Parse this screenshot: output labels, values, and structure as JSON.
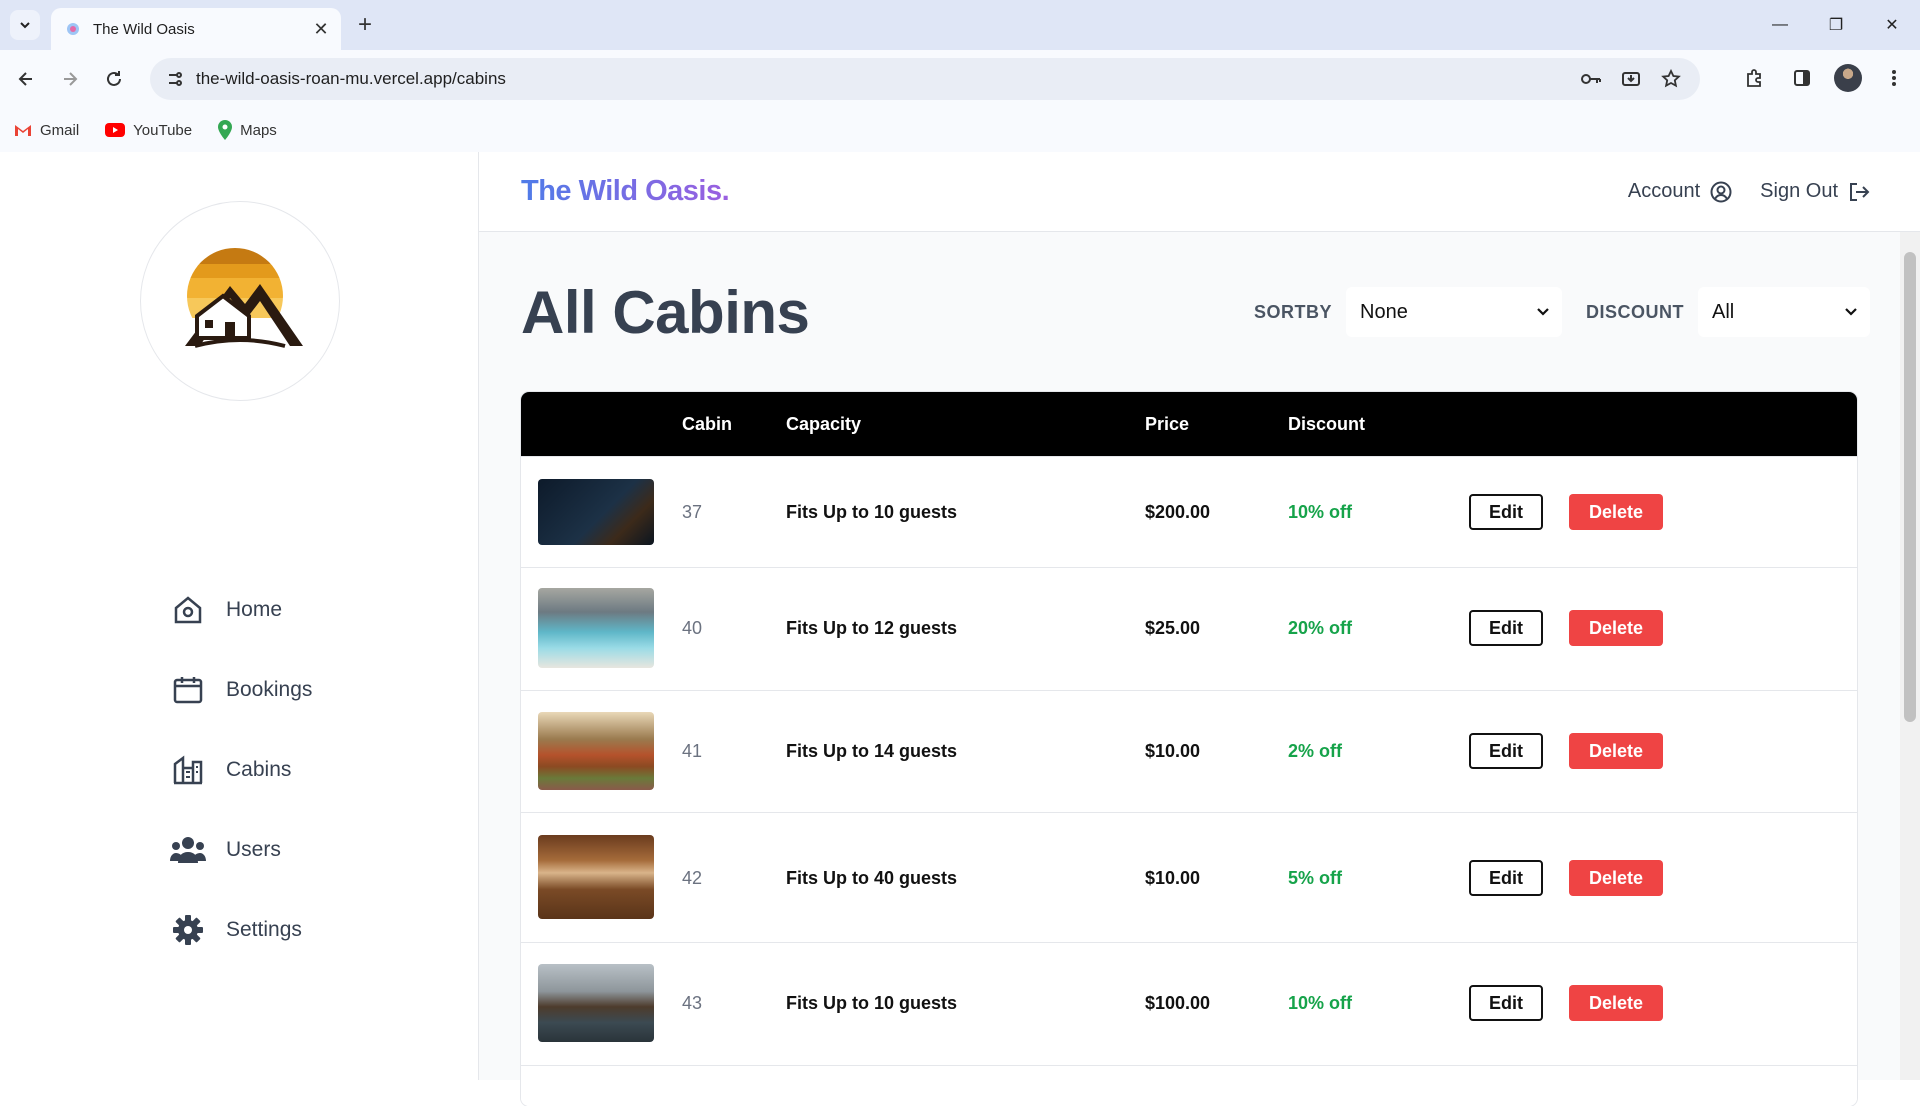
{
  "browser": {
    "tab_title": "The Wild Oasis",
    "url": "the-wild-oasis-roan-mu.vercel.app/cabins",
    "bookmarks": [
      {
        "label": "Gmail",
        "icon": "gmail-icon"
      },
      {
        "label": "YouTube",
        "icon": "youtube-icon"
      },
      {
        "label": "Maps",
        "icon": "maps-icon"
      }
    ]
  },
  "sidebar": {
    "items": [
      {
        "label": "Home",
        "icon": "home-icon"
      },
      {
        "label": "Bookings",
        "icon": "calendar-icon"
      },
      {
        "label": "Cabins",
        "icon": "building-icon"
      },
      {
        "label": "Users",
        "icon": "users-icon"
      },
      {
        "label": "Settings",
        "icon": "gear-icon"
      }
    ]
  },
  "header": {
    "brand": "The Wild Oasis.",
    "account_label": "Account",
    "signout_label": "Sign Out"
  },
  "page": {
    "title": "All Cabins",
    "sortby_label": "SORTBY",
    "sortby_value": "None",
    "discount_label": "DISCOUNT",
    "discount_value": "All"
  },
  "table": {
    "headers": {
      "cabin": "Cabin",
      "capacity": "Capacity",
      "price": "Price",
      "discount": "Discount"
    },
    "edit_label": "Edit",
    "delete_label": "Delete",
    "rows": [
      {
        "cabin": "37",
        "capacity": "Fits Up to 10 guests",
        "price": "$200.00",
        "discount": "10% off"
      },
      {
        "cabin": "40",
        "capacity": "Fits Up to 12 guests",
        "price": "$25.00",
        "discount": "20% off"
      },
      {
        "cabin": "41",
        "capacity": "Fits Up to 14 guests",
        "price": "$10.00",
        "discount": "2% off"
      },
      {
        "cabin": "42",
        "capacity": "Fits Up to 40 guests",
        "price": "$10.00",
        "discount": "5% off"
      },
      {
        "cabin": "43",
        "capacity": "Fits Up to 10 guests",
        "price": "$100.00",
        "discount": "10% off"
      }
    ]
  },
  "colors": {
    "accent_delete": "#ef4444",
    "discount_green": "#16a34a",
    "brand_gradient_start": "#4f7ce8",
    "brand_gradient_end": "#9b5fe0"
  }
}
